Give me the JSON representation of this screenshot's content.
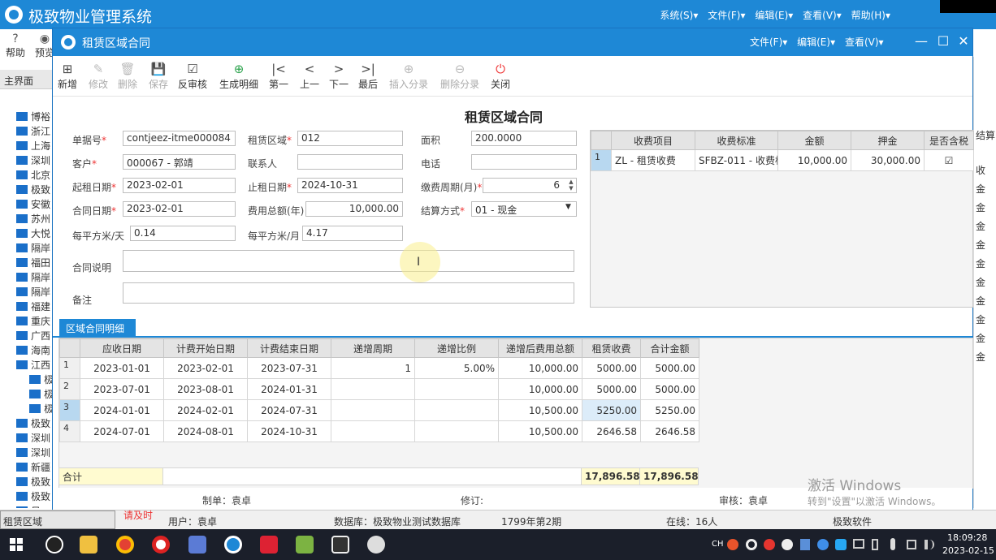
{
  "app": {
    "title": "极致物业管理系统",
    "menu": [
      "系统(S)▾",
      "文件(F)▾",
      "编辑(E)▾",
      "查看(V)▾",
      "帮助(H)▾"
    ],
    "toolbar": [
      {
        "label": "帮助",
        "icon": "?"
      },
      {
        "label": "预览",
        "icon": "◉"
      }
    ],
    "home_tab": "主界面",
    "tree": [
      "博裕",
      "浙江",
      "上海",
      "深圳",
      "北京",
      "极致",
      "安徽",
      "苏州",
      "大悦",
      "隔岸",
      "福田",
      "隔岸",
      "隔岸",
      "福建",
      "重庆",
      "广西",
      "海南",
      "江西",
      "极",
      "极",
      "极",
      "极致",
      "深圳",
      "深圳",
      "新疆",
      "极致",
      "极致",
      "见"
    ],
    "right_strip": [
      "结算",
      "收",
      "金",
      "金",
      "金",
      "金",
      "金",
      "金",
      "金",
      "金",
      "金",
      "金"
    ]
  },
  "window": {
    "title": "租赁区域合同",
    "menu": [
      "文件(F)▾",
      "编辑(E)▾",
      "查看(V)▾"
    ],
    "controls": [
      "—",
      "☐",
      "✕"
    ]
  },
  "toolbar": [
    {
      "name": "new",
      "label": "新增",
      "icon": "⊞",
      "state": "normal"
    },
    {
      "name": "edit",
      "label": "修改",
      "icon": "✎",
      "state": "dis"
    },
    {
      "name": "delete",
      "label": "删除",
      "icon": "🗑",
      "state": "dis"
    },
    {
      "name": "save",
      "label": "保存",
      "icon": "💾",
      "state": "dis"
    },
    {
      "name": "unaudit",
      "label": "反审核",
      "icon": "☑",
      "state": "normal"
    },
    {
      "name": "gen-detail",
      "label": "生成明细",
      "icon": "⊕",
      "state": "green"
    },
    {
      "name": "first",
      "label": "第一",
      "icon": "|<",
      "state": "normal"
    },
    {
      "name": "prev",
      "label": "上一",
      "icon": "<",
      "state": "normal"
    },
    {
      "name": "next",
      "label": "下一",
      "icon": ">",
      "state": "normal"
    },
    {
      "name": "last",
      "label": "最后",
      "icon": ">|",
      "state": "normal"
    },
    {
      "name": "insert-entry",
      "label": "插入分录",
      "icon": "⊕",
      "state": "dis"
    },
    {
      "name": "delete-entry",
      "label": "删除分录",
      "icon": "⊖",
      "state": "dis"
    },
    {
      "name": "close",
      "label": "关闭",
      "icon": "⏻",
      "state": "red"
    }
  ],
  "form": {
    "title": "租赁区域合同",
    "doc_no": {
      "label": "单据号",
      "value": "contjeez-itme000084"
    },
    "area_region": {
      "label": "租赁区域",
      "value": "012"
    },
    "area": {
      "label": "面积",
      "value": "200.0000"
    },
    "customer": {
      "label": "客户",
      "value": "000067 - 郭靖"
    },
    "contact": {
      "label": "联系人",
      "value": ""
    },
    "phone": {
      "label": "电话",
      "value": ""
    },
    "start_date": {
      "label": "起租日期",
      "value": "2023-02-01"
    },
    "end_date": {
      "label": "止租日期",
      "value": "2024-10-31"
    },
    "pay_cycle": {
      "label": "缴费周期(月)",
      "value": "6"
    },
    "contract_date": {
      "label": "合同日期",
      "value": "2023-02-01"
    },
    "total_fee": {
      "label": "费用总额(年)",
      "value": "10,000.00"
    },
    "settle": {
      "label": "结算方式",
      "value": "01 - 现金"
    },
    "per_day": {
      "label": "每平方米/天",
      "value": "0.14"
    },
    "per_month": {
      "label": "每平方米/月",
      "value": "4.17"
    },
    "note": {
      "label": "合同说明",
      "value": ""
    },
    "remark": {
      "label": "备注",
      "value": ""
    }
  },
  "fee_grid": {
    "headers": [
      "收费项目",
      "收费标准",
      "金额",
      "押金",
      "是否含税"
    ],
    "rows": [
      {
        "no": "1",
        "item": "ZL - 租赁收费",
        "std": "SFBZ-011 - 收费标准",
        "amount": "10,000.00",
        "deposit": "30,000.00",
        "tax": "☑"
      }
    ]
  },
  "detail": {
    "tab": "区域合同明细",
    "headers": [
      "应收日期",
      "计费开始日期",
      "计费结束日期",
      "递增周期",
      "递增比例",
      "递增后费用总额",
      "租赁收费",
      "合计金额"
    ],
    "rows": [
      {
        "no": "1",
        "due": "2023-01-01",
        "start": "2023-02-01",
        "end": "2023-07-31",
        "cycle": "1",
        "ratio": "5.00%",
        "total": "10,000.00",
        "rent": "5000.00",
        "sum": "5000.00"
      },
      {
        "no": "2",
        "due": "2023-07-01",
        "start": "2023-08-01",
        "end": "2024-01-31",
        "cycle": "",
        "ratio": "",
        "total": "10,000.00",
        "rent": "5000.00",
        "sum": "5000.00"
      },
      {
        "no": "3",
        "due": "2024-01-01",
        "start": "2024-02-01",
        "end": "2024-07-31",
        "cycle": "",
        "ratio": "",
        "total": "10,500.00",
        "rent": "5250.00",
        "sum": "5250.00"
      },
      {
        "no": "4",
        "due": "2024-07-01",
        "start": "2024-08-01",
        "end": "2024-10-31",
        "cycle": "",
        "ratio": "",
        "total": "10,500.00",
        "rent": "2646.58",
        "sum": "2646.58"
      }
    ],
    "sum_label": "合计",
    "sum_rent": "17,896.58",
    "sum_total": "17,896.58"
  },
  "footer": {
    "maker": "制单：袁卓",
    "reviser": "修订:",
    "auditor": "审核：袁卓"
  },
  "status": {
    "module": "租赁区域",
    "tip": "请及时",
    "user": "用户：袁卓",
    "db": "数据库：极致物业测试数据库",
    "period": "1799年第2期",
    "online": "在线：16人",
    "brand": "极致软件"
  },
  "watermark": {
    "line1": "激活 Windows",
    "line2": "转到\"设置\"以激活 Windows。"
  },
  "taskbar": {
    "ime": "CH",
    "time": "18:09:28",
    "date": "2023-02-15"
  }
}
